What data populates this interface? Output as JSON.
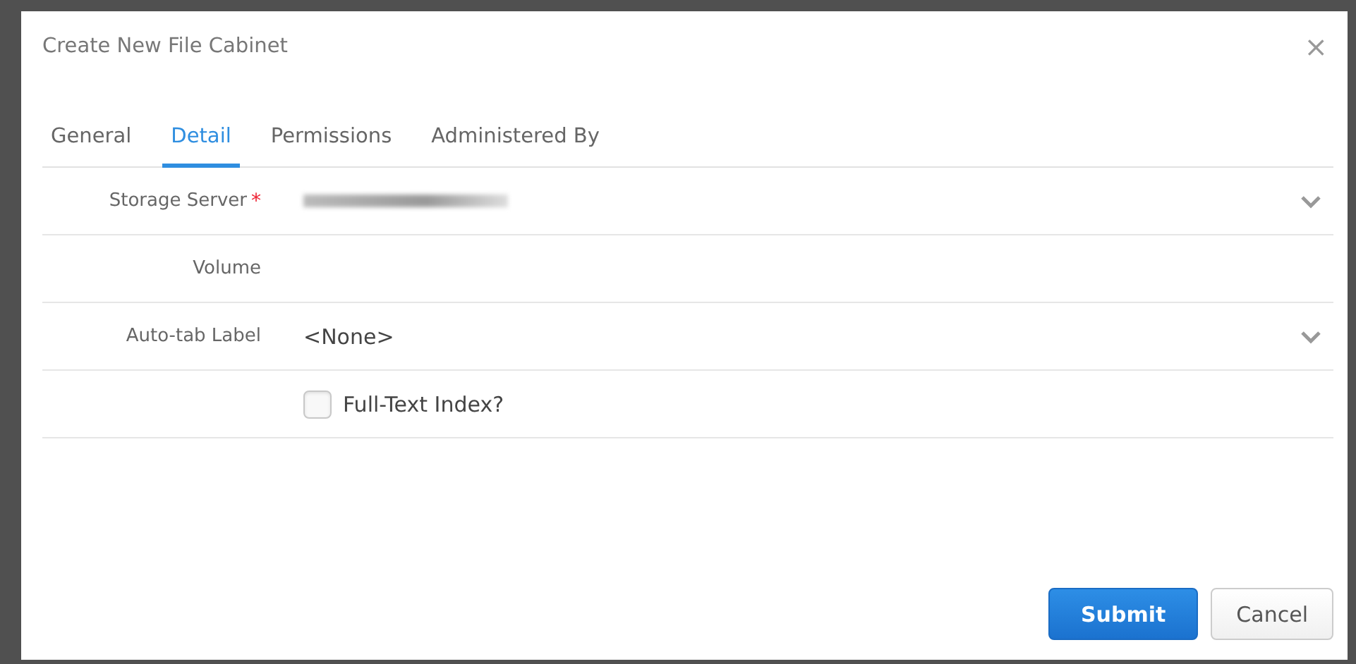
{
  "dialog": {
    "title": "Create New File Cabinet",
    "close": "×"
  },
  "tabs": [
    {
      "label": "General",
      "selected": false
    },
    {
      "label": "Detail",
      "selected": true
    },
    {
      "label": "Permissions",
      "selected": false
    },
    {
      "label": "Administered By",
      "selected": false
    }
  ],
  "fields": [
    {
      "kind": "select",
      "label": "Storage Server",
      "required_mark": "*"
    },
    {
      "kind": "plain",
      "label": "Volume"
    },
    {
      "kind": "select",
      "label": "Auto-tab Label",
      "value": "<None>"
    },
    {
      "kind": "checkbox",
      "text": "Full-Text Index?",
      "checked": false
    }
  ],
  "buttons": [
    {
      "label": "Submit",
      "kind": "primary"
    },
    {
      "label": "Cancel",
      "kind": "secondary"
    }
  ]
}
